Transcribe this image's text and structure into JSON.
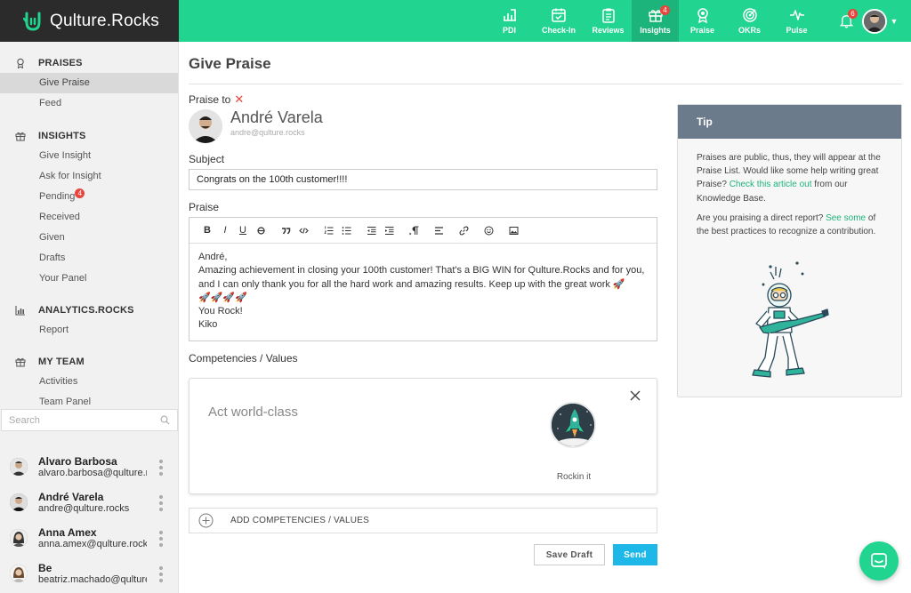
{
  "brand": {
    "name": "Qulture.Rocks"
  },
  "nav": {
    "items": [
      {
        "label": "PDI",
        "icon": "chart-up-icon"
      },
      {
        "label": "Check-In",
        "icon": "calendar-check-icon"
      },
      {
        "label": "Reviews",
        "icon": "clipboard-icon"
      },
      {
        "label": "Insights",
        "icon": "gift-icon",
        "badge": "4",
        "active": true
      },
      {
        "label": "Praise",
        "icon": "medal-icon"
      },
      {
        "label": "OKRs",
        "icon": "target-icon"
      },
      {
        "label": "Pulse",
        "icon": "pulse-icon"
      }
    ],
    "notifications_badge": "6",
    "accent": "#21d48f"
  },
  "sidebar": {
    "sections": [
      {
        "title": "PRAISES",
        "icon": "medal-icon",
        "items": [
          "Give Praise",
          "Feed"
        ]
      },
      {
        "title": "INSIGHTS",
        "icon": "gift-icon",
        "items": [
          "Give Insight",
          "Ask for Insight",
          "Pending",
          "Received",
          "Given",
          "Drafts",
          "Your Panel"
        ],
        "pending_badge": "4"
      },
      {
        "title": "ANALYTICS.ROCKS",
        "icon": "bar-chart-icon",
        "items": [
          "Report"
        ]
      },
      {
        "title": "MY TEAM",
        "icon": "gift-icon",
        "items": [
          "Activities",
          "Team Panel"
        ]
      }
    ],
    "search_placeholder": "Search",
    "people": [
      {
        "name": "Alvaro Barbosa",
        "email": "alvaro.barbosa@qulture.rocks"
      },
      {
        "name": "André Varela",
        "email": "andre@qulture.rocks"
      },
      {
        "name": "Anna Amex",
        "email": "anna.amex@qulture.rocks"
      },
      {
        "name": "Be",
        "email": "beatriz.machado@qulture.rocks"
      }
    ]
  },
  "main": {
    "title": "Give Praise",
    "praise_to_label": "Praise to",
    "recipient": {
      "name": "André Varela",
      "email": "andre@qulture.rocks"
    },
    "subject_label": "Subject",
    "subject_value": "Congrats on the 100th customer!!!!",
    "praise_label": "Praise",
    "praise_lines": [
      "André,",
      "Amazing achievement in closing your 100th customer! That's a BIG WIN for Qulture.Rocks and for you,",
      "and I can only thank you for all the hard work and amazing results. Keep up with the great work 🚀",
      "🚀🚀🚀🚀",
      "You Rock!",
      "Kiko"
    ],
    "competencies_label": "Competencies / Values",
    "competency": {
      "name": "Act world-class",
      "badge_label": "Rockin it"
    },
    "add_competencies_label": "ADD COMPETENCIES / VALUES",
    "save_draft_label": "Save Draft",
    "send_label": "Send"
  },
  "tip": {
    "title": "Tip",
    "p1_before": "Praises are public, thus, they will appear at the Praise List. Would like some help writing great Praise? ",
    "p1_link": "Check this article out",
    "p1_after": " from our Knowledge Base.",
    "p2_before": "Are you praising a direct report? ",
    "p2_link": "See some",
    "p2_after": " of the best practices to recognize a contribution."
  }
}
